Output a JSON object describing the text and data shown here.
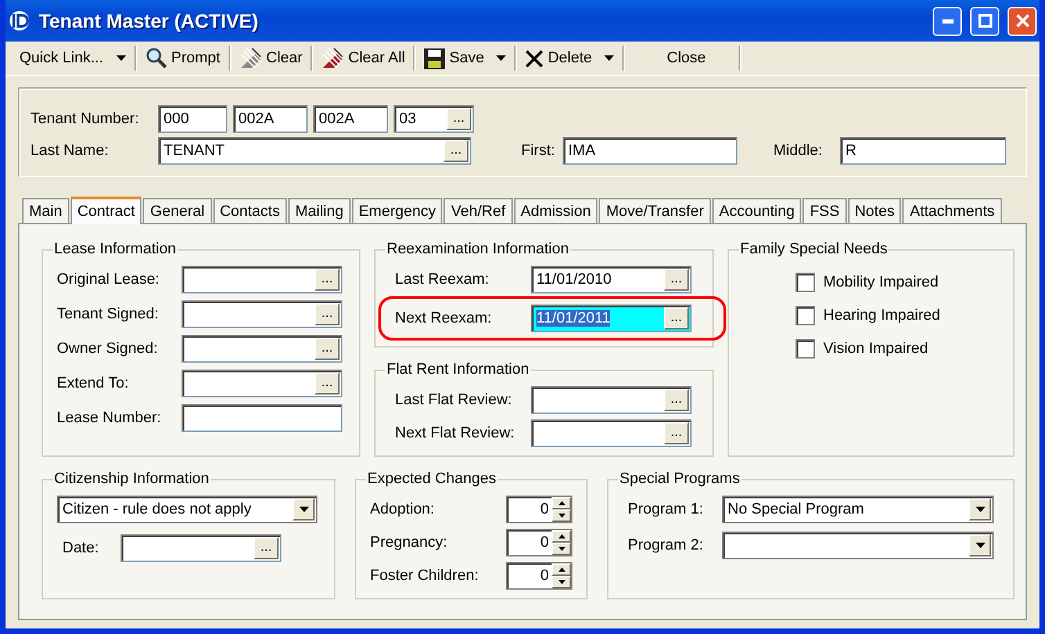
{
  "window": {
    "title": "Tenant Master (ACTIVE)"
  },
  "toolbar": [
    {
      "label": "Quick Link...",
      "kind": "menu",
      "dropdown": true
    },
    {
      "label": "Prompt",
      "kind": "search",
      "dropdown": false
    },
    {
      "label": "Clear",
      "kind": "clear",
      "dropdown": false
    },
    {
      "label": "Clear All",
      "kind": "clear-all",
      "dropdown": false
    },
    {
      "label": "Save",
      "kind": "save",
      "dropdown": true
    },
    {
      "label": "Delete",
      "kind": "delete",
      "dropdown": true
    },
    {
      "label": "Close",
      "kind": "close",
      "dropdown": false
    }
  ],
  "header": {
    "tenant_number_label": "Tenant Number:",
    "tenant_number": [
      "000",
      "002A",
      "002A",
      "03"
    ],
    "tenant_number_button": "...",
    "last_name_label": "Last Name:",
    "last_name": "TENANT",
    "last_name_button": "...",
    "first_label": "First:",
    "first": "IMA",
    "middle_label": "Middle:",
    "middle": "R"
  },
  "tabs": [
    {
      "label": "Main",
      "selected": false
    },
    {
      "label": "Contract",
      "selected": true
    },
    {
      "label": "General",
      "selected": false
    },
    {
      "label": "Contacts",
      "selected": false
    },
    {
      "label": "Mailing",
      "selected": false
    },
    {
      "label": "Emergency",
      "selected": false
    },
    {
      "label": "Veh/Ref",
      "selected": false
    },
    {
      "label": "Admission",
      "selected": false
    },
    {
      "label": "Move/Transfer",
      "selected": false
    },
    {
      "label": "Accounting",
      "selected": false
    },
    {
      "label": "FSS",
      "selected": false
    },
    {
      "label": "Notes",
      "selected": false
    },
    {
      "label": "Attachments",
      "selected": false
    }
  ],
  "lease": {
    "title": "Lease Information",
    "fields": [
      {
        "label": "Original Lease:",
        "button": "..."
      },
      {
        "label": "Tenant Signed:",
        "button": "..."
      },
      {
        "label": "Owner Signed:",
        "button": "..."
      },
      {
        "label": "Extend To:",
        "button": "..."
      },
      {
        "label": "Lease Number:"
      }
    ]
  },
  "reexam": {
    "title": "Reexamination Information",
    "fields": [
      {
        "label": "Last Reexam:",
        "value": "11/01/2010",
        "button": "...",
        "focused": false,
        "highlighted": false
      },
      {
        "label": "Next Reexam:",
        "value": "11/01/2011",
        "button": "...",
        "focused": true,
        "highlighted": true
      }
    ]
  },
  "flat_rent": {
    "title": "Flat Rent Information",
    "fields": [
      {
        "label": "Last Flat Review:",
        "button": "..."
      },
      {
        "label": "Next Flat Review:",
        "button": "..."
      }
    ]
  },
  "family_needs": {
    "title": "Family Special Needs",
    "items": [
      {
        "label": "Mobility Impaired",
        "checked": false
      },
      {
        "label": "Hearing Impaired",
        "checked": false
      },
      {
        "label": "Vision Impaired",
        "checked": false
      }
    ]
  },
  "citizenship": {
    "title": "Citizenship Information",
    "status": "Citizen - rule does not apply",
    "date_label": "Date:",
    "date_button": "..."
  },
  "expected_changes": {
    "title": "Expected Changes",
    "items": [
      {
        "label": "Adoption:",
        "value": "0"
      },
      {
        "label": "Pregnancy:",
        "value": "0"
      },
      {
        "label": "Foster Children:",
        "value": "0"
      }
    ]
  },
  "special_programs": {
    "title": "Special Programs",
    "items": [
      {
        "label": "Program 1:",
        "value": "No Special Program"
      },
      {
        "label": "Program 2:"
      }
    ]
  }
}
